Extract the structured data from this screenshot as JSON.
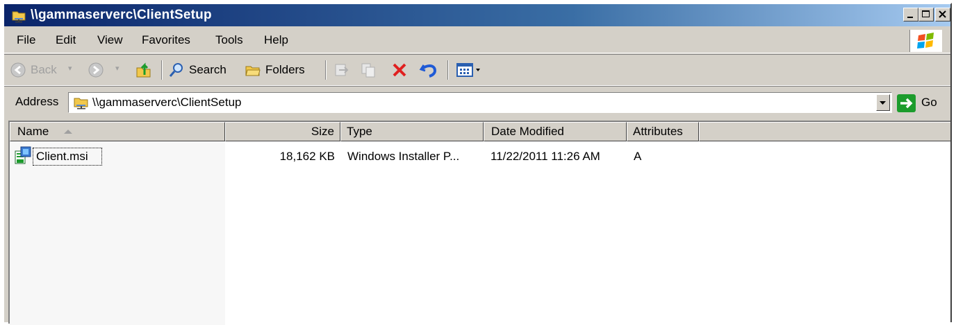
{
  "window": {
    "title": "\\\\gammaserverc\\ClientSetup",
    "caption_buttons": [
      "minimize",
      "maximize",
      "close"
    ]
  },
  "menu": {
    "file": "File",
    "edit": "Edit",
    "view": "View",
    "favorites": "Favorites",
    "tools": "Tools",
    "help": "Help"
  },
  "toolbar": {
    "back_label": "Back",
    "search_label": "Search",
    "folders_label": "Folders"
  },
  "address": {
    "label": "Address",
    "value": "\\\\gammaserverc\\ClientSetup",
    "go_label": "Go"
  },
  "list": {
    "columns": {
      "name": "Name",
      "size": "Size",
      "type": "Type",
      "date": "Date Modified",
      "attributes": "Attributes"
    },
    "rows": [
      {
        "name": "Client.msi",
        "size": "18,162 KB",
        "type": "Windows Installer P...",
        "date": "11/22/2011 11:26 AM",
        "attributes": "A"
      }
    ]
  },
  "colors": {
    "title_bar_start": "#0a246a",
    "title_bar_end": "#a6caf0",
    "chrome": "#d4d0c8",
    "delete_red": "#e02020",
    "go_green": "#1c9c2c"
  }
}
